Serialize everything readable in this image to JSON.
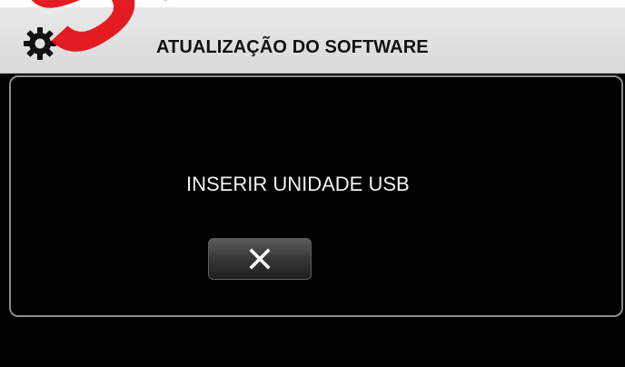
{
  "header": {
    "icon": "gear-icon",
    "title": "ATUALIZAÇÃO DO SOFTWARE"
  },
  "dialog": {
    "message": "INSERIR UNIDADE USB",
    "close_icon": "close-icon"
  },
  "watermark": {
    "text": "SED"
  },
  "colors": {
    "header_bg": "#e0e0e0",
    "screen_bg": "#000000",
    "text_light": "#f2f2f2",
    "watermark": "#e3111a"
  }
}
